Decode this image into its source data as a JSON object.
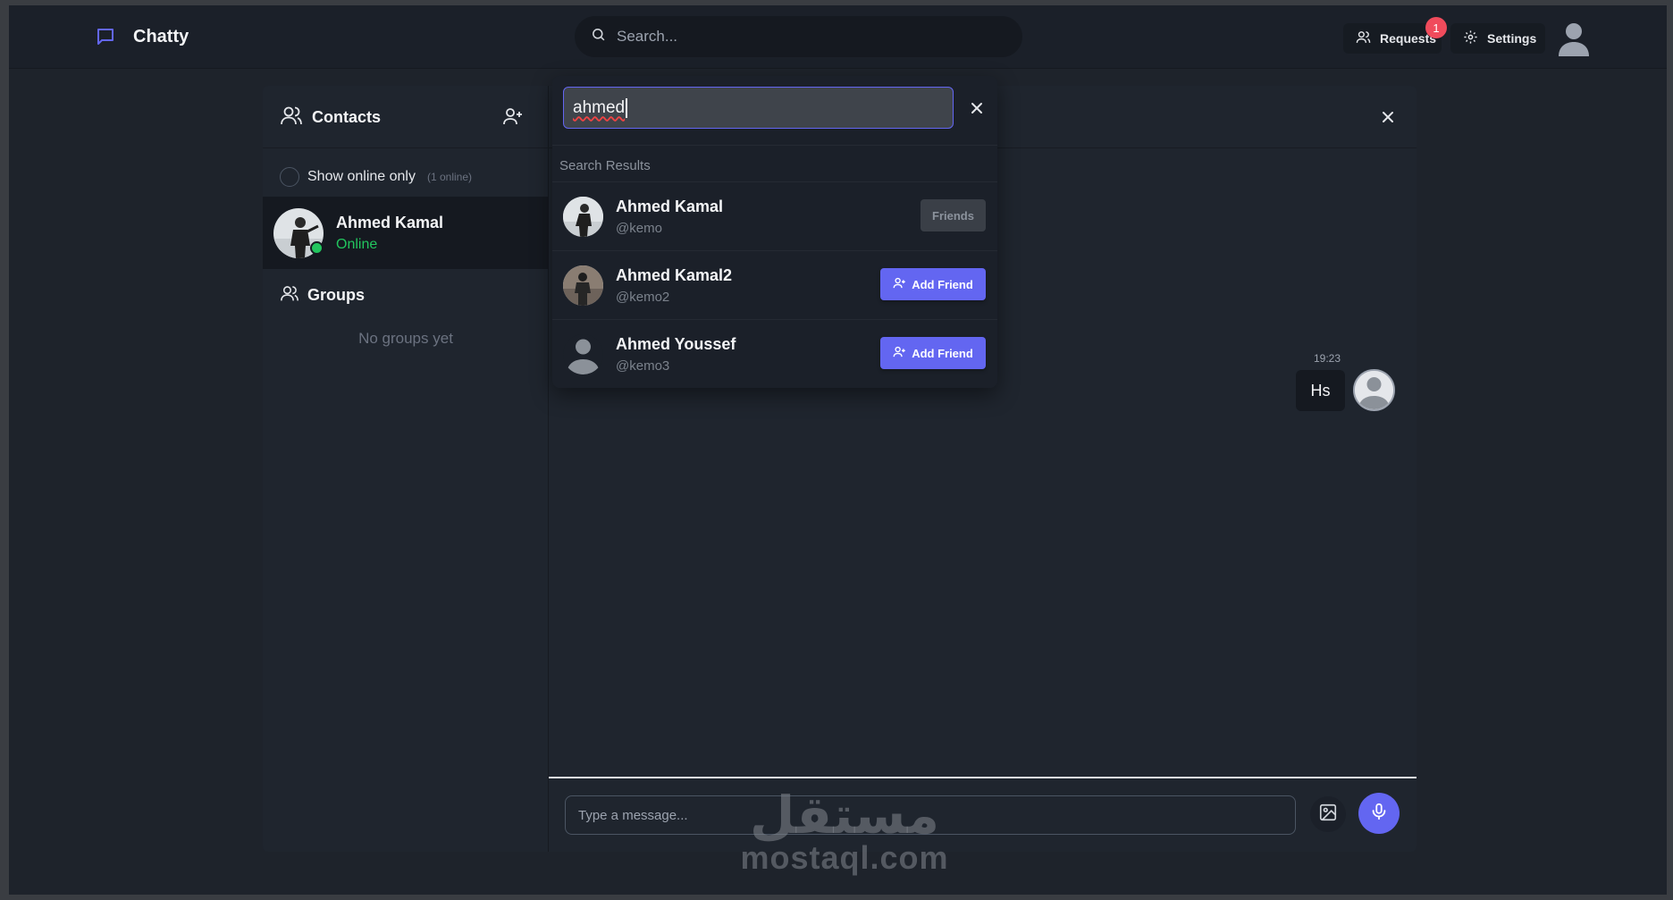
{
  "app": {
    "brand_name": "Chatty",
    "brand_color": "#6366f1"
  },
  "navbar": {
    "search_placeholder": "Search...",
    "requests_label": "Requests",
    "requests_badge": "1",
    "settings_label": "Settings"
  },
  "sidebar": {
    "title": "Contacts",
    "online_filter_label": "Show online only",
    "online_count": "(1 online)",
    "contacts": [
      {
        "name": "Ahmed Kamal",
        "status": "Online"
      }
    ],
    "groups_title": "Groups",
    "groups_empty": "No groups yet"
  },
  "chat": {
    "messages": [
      {
        "time": "19:23",
        "text": "Hs"
      }
    ],
    "input_placeholder": "Type a message..."
  },
  "search_popup": {
    "query": "ahmed",
    "results_label": "Search Results",
    "results": [
      {
        "name": "Ahmed Kamal",
        "username": "@kemo",
        "action": "Friends"
      },
      {
        "name": "Ahmed Kamal2",
        "username": "@kemo2",
        "action": "Add Friend"
      },
      {
        "name": "Ahmed Youssef",
        "username": "@kemo3",
        "action": "Add Friend"
      }
    ]
  },
  "watermark": {
    "arabic": "مستقل",
    "latin": "mostaql.com"
  },
  "colors": {
    "accent": "#6366f1",
    "online": "#22c55e",
    "badge": "#f04b5c"
  }
}
